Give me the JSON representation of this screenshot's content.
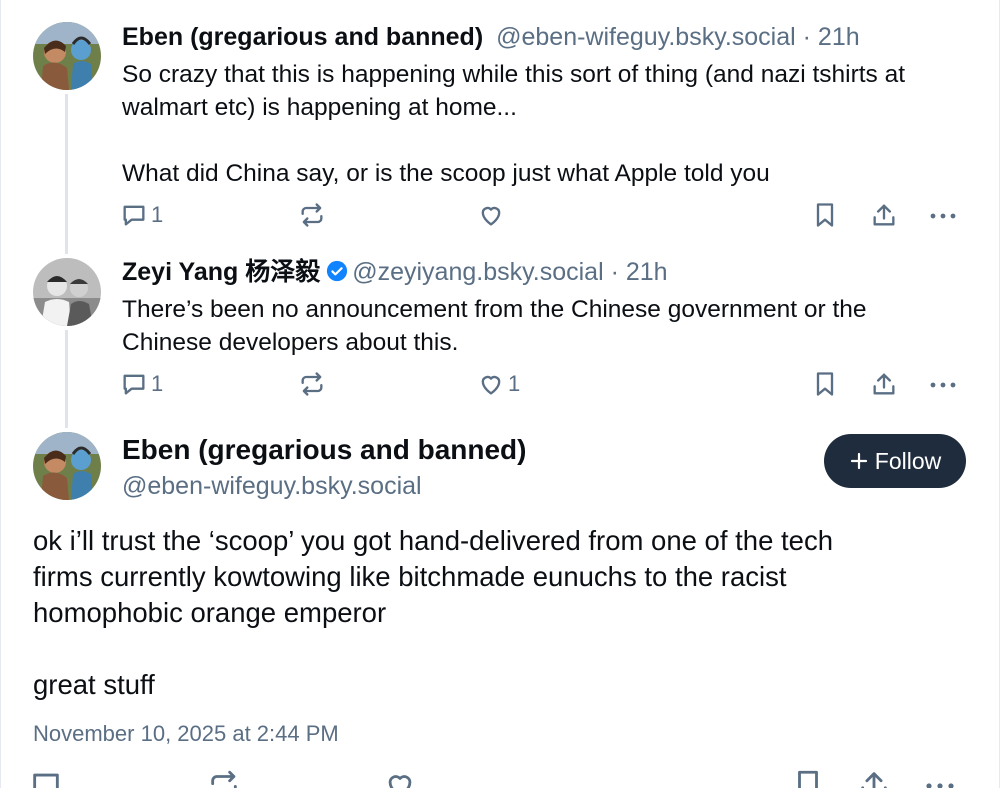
{
  "posts": [
    {
      "author_name": "Eben (gregarious and banned)",
      "handle": "@eben-wifeguy.bsky.social",
      "separator": " · ",
      "time": "21h",
      "text_lines": [
        "So crazy that this is happening while this sort of thing (and nazi tshirts at",
        "walmart etc) is happening at home...",
        "",
        "What did China say, or is the scoop just what Apple told you"
      ],
      "reply_count": "1",
      "repost_count": "",
      "like_count": ""
    },
    {
      "author_name": "Zeyi Yang 杨泽毅",
      "verified": true,
      "handle": "@zeyiyang.bsky.social",
      "separator": " · ",
      "time": "21h",
      "text_lines": [
        "There’s been no announcement from the Chinese government or the",
        "Chinese developers about this."
      ],
      "reply_count": "1",
      "repost_count": "",
      "like_count": "1"
    }
  ],
  "main_post": {
    "author_name": "Eben (gregarious and banned)",
    "handle": "@eben-wifeguy.bsky.social",
    "follow_label": "Follow",
    "text_lines": [
      "ok i’ll trust the ‘scoop’ you got hand-delivered from one of the tech",
      "firms currently kowtowing like bitchmade eunuchs to the racist",
      "homophobic orange emperor",
      "",
      "great stuff"
    ],
    "timestamp": "November 10, 2025 at 2:44 PM"
  },
  "icons": {
    "reply": "reply-icon",
    "repost": "repost-icon",
    "like": "heart-icon",
    "bookmark": "bookmark-icon",
    "share": "share-icon",
    "more": "more-icon",
    "verified": "verified-badge-icon"
  },
  "colors": {
    "text": "#0b0f14",
    "muted": "#5a6e84",
    "thread_line": "#dfe4ea",
    "follow_button": "#1f2c3d",
    "verified": "#1083fe"
  }
}
